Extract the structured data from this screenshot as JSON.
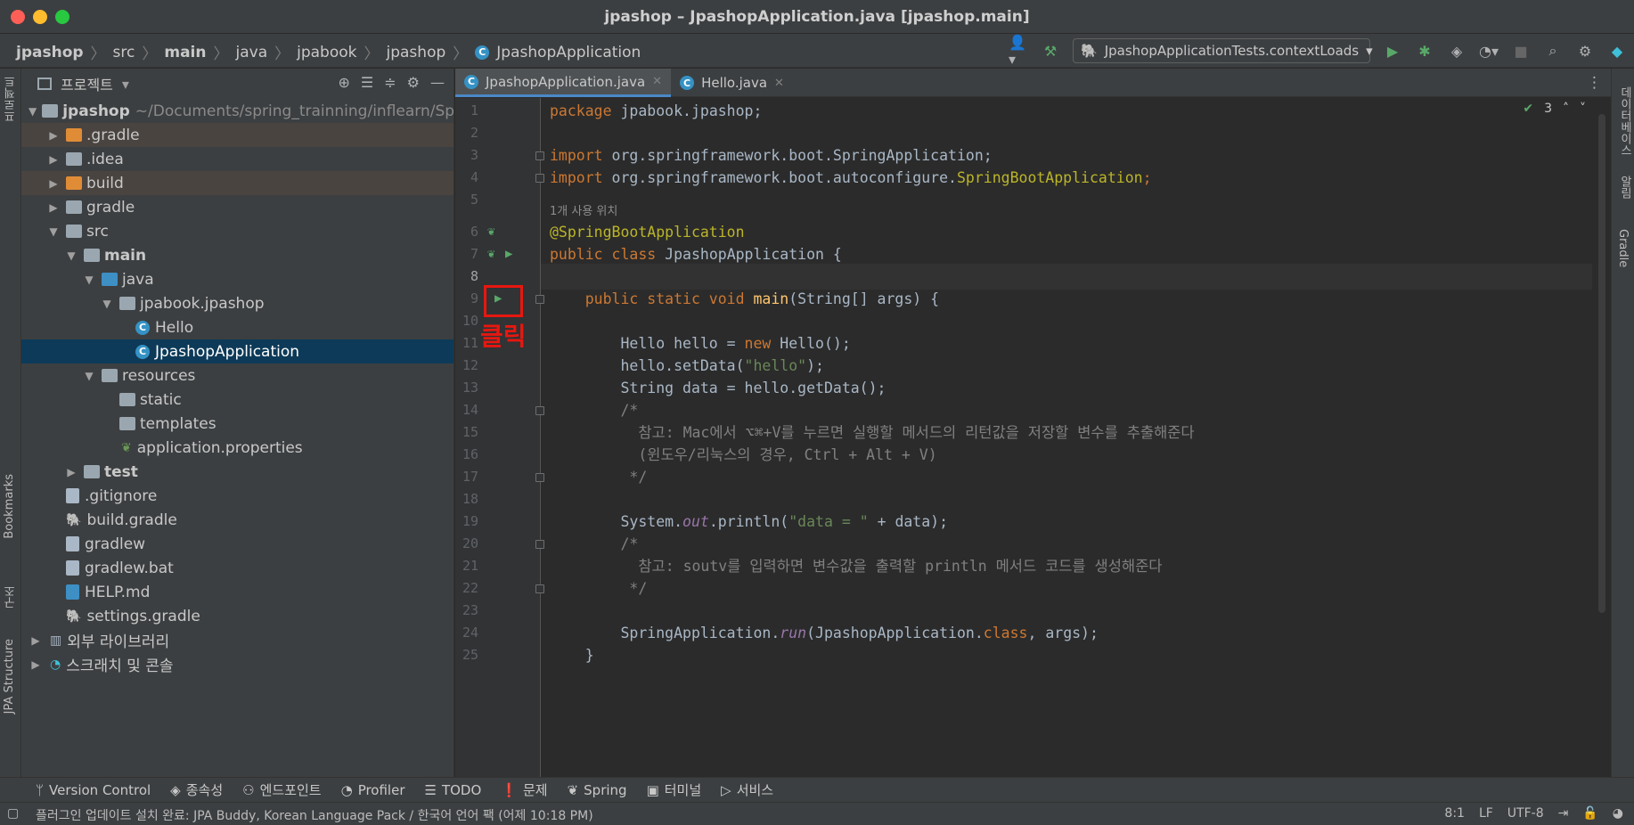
{
  "window": {
    "title": "jpashop – JpashopApplication.java [jpashop.main]"
  },
  "breadcrumb": [
    "jpashop",
    "src",
    "main",
    "java",
    "jpabook",
    "jpashop",
    "JpashopApplication"
  ],
  "run_config": {
    "label": "JpashopApplicationTests.contextLoads"
  },
  "left_strip": {
    "project_tab": "프로젝트",
    "bookmarks_tab": "Bookmarks",
    "structure_tab": "구조",
    "jpa_tab": "JPA Structure"
  },
  "right_strip": {
    "database_tab": "데이터베이스",
    "notifications_tab": "알림",
    "gradle_tab": "Gradle"
  },
  "project_panel": {
    "title": "프로젝트",
    "root_name": "jpashop",
    "root_path": "~/Documents/spring_trainning/inflearn/Spri",
    "items": [
      {
        "label": ".gradle"
      },
      {
        "label": ".idea"
      },
      {
        "label": "build"
      },
      {
        "label": "gradle"
      },
      {
        "label": "src"
      },
      {
        "label": "main"
      },
      {
        "label": "java"
      },
      {
        "label": "jpabook.jpashop"
      },
      {
        "label": "Hello"
      },
      {
        "label": "JpashopApplication"
      },
      {
        "label": "resources"
      },
      {
        "label": "static"
      },
      {
        "label": "templates"
      },
      {
        "label": "application.properties"
      },
      {
        "label": "test"
      },
      {
        "label": ".gitignore"
      },
      {
        "label": "build.gradle"
      },
      {
        "label": "gradlew"
      },
      {
        "label": "gradlew.bat"
      },
      {
        "label": "HELP.md"
      },
      {
        "label": "settings.gradle"
      },
      {
        "label": "외부 라이브러리"
      },
      {
        "label": "스크래치 및 콘솔"
      }
    ]
  },
  "tabs": [
    {
      "label": "JpashopApplication.java"
    },
    {
      "label": "Hello.java"
    }
  ],
  "editor": {
    "inspection_count": "3",
    "usage_hint": "1개 사용 위치",
    "annotation_label": "클릭",
    "line_numbers": [
      "1",
      "2",
      "3",
      "4",
      "5",
      "6",
      "7",
      "8",
      "9",
      "10",
      "11",
      "12",
      "13",
      "14",
      "15",
      "16",
      "17",
      "18",
      "19",
      "20",
      "21",
      "22",
      "23",
      "24",
      "25"
    ],
    "code": {
      "l1a": "package",
      "l1b": " jpabook.jpashop;",
      "l3a": "import",
      "l3b": " org.springframework.boot.SpringApplication;",
      "l4a": "import",
      "l4b": " org.springframework.boot.autoconfigure.",
      "l4c": "SpringBootApplication",
      "l4d": ";",
      "l6": "@SpringBootApplication",
      "l7a": "public class",
      "l7b": " JpashopApplication {",
      "l9a": "    public static void",
      "l9b": " main",
      "l9c": "(String[] args) {",
      "l11a": "        Hello hello = ",
      "l11b": "new",
      "l11c": " Hello();",
      "l12a": "        hello.setData(",
      "l12b": "\"hello\"",
      "l12c": ");",
      "l13": "        String data = hello.getData();",
      "l14": "        /*",
      "l15": "          참고: Mac에서 ⌥⌘+V를 누르면 실행할 메서드의 리턴값을 저장할 변수를 추출해준다",
      "l16": "          (윈도우/리눅스의 경우, Ctrl + Alt + V)",
      "l17": "         */",
      "l19a": "        System.",
      "l19b": "out",
      "l19c": ".println(",
      "l19d": "\"data = \"",
      "l19e": " + data);",
      "l20": "        /*",
      "l21": "          참고: soutv를 입력하면 변수값을 출력할 println 메서드 코드를 생성해준다",
      "l22": "         */",
      "l24a": "        SpringApplication.",
      "l24b": "run",
      "l24c": "(JpashopApplication.",
      "l24d": "class",
      "l24e": ", args);",
      "l25": "    }"
    }
  },
  "bottom_tools": [
    "Version Control",
    "종속성",
    "엔드포인트",
    "Profiler",
    "TODO",
    "문제",
    "Spring",
    "터미널",
    "서비스"
  ],
  "status": {
    "message": "플러그인 업데이트 설치 완료: JPA Buddy, Korean Language Pack / 한국어 언어 팩 (어제 10:18 PM)",
    "position": "8:1",
    "line_sep": "LF",
    "encoding": "UTF-8"
  }
}
